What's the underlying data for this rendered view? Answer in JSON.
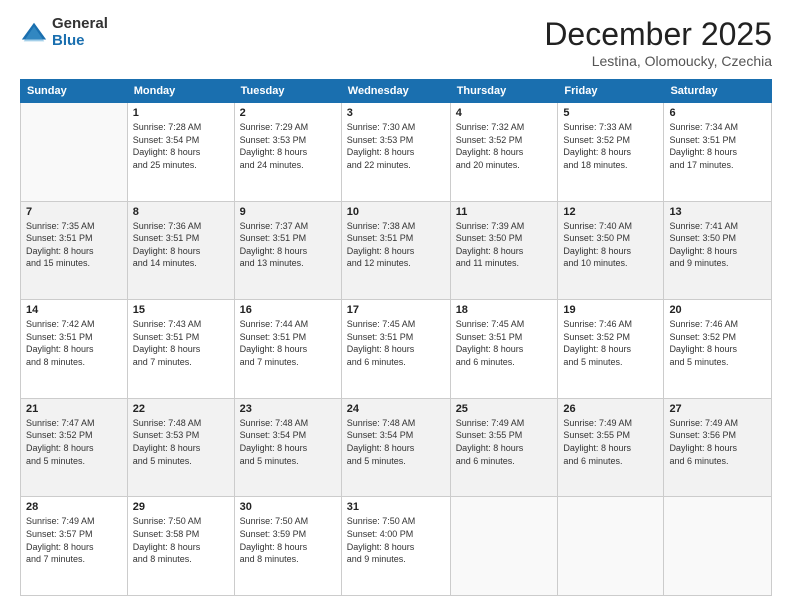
{
  "logo": {
    "general": "General",
    "blue": "Blue"
  },
  "header": {
    "month": "December 2025",
    "location": "Lestina, Olomoucky, Czechia"
  },
  "days_of_week": [
    "Sunday",
    "Monday",
    "Tuesday",
    "Wednesday",
    "Thursday",
    "Friday",
    "Saturday"
  ],
  "weeks": [
    [
      {
        "num": "",
        "info": ""
      },
      {
        "num": "1",
        "info": "Sunrise: 7:28 AM\nSunset: 3:54 PM\nDaylight: 8 hours\nand 25 minutes."
      },
      {
        "num": "2",
        "info": "Sunrise: 7:29 AM\nSunset: 3:53 PM\nDaylight: 8 hours\nand 24 minutes."
      },
      {
        "num": "3",
        "info": "Sunrise: 7:30 AM\nSunset: 3:53 PM\nDaylight: 8 hours\nand 22 minutes."
      },
      {
        "num": "4",
        "info": "Sunrise: 7:32 AM\nSunset: 3:52 PM\nDaylight: 8 hours\nand 20 minutes."
      },
      {
        "num": "5",
        "info": "Sunrise: 7:33 AM\nSunset: 3:52 PM\nDaylight: 8 hours\nand 18 minutes."
      },
      {
        "num": "6",
        "info": "Sunrise: 7:34 AM\nSunset: 3:51 PM\nDaylight: 8 hours\nand 17 minutes."
      }
    ],
    [
      {
        "num": "7",
        "info": "Sunrise: 7:35 AM\nSunset: 3:51 PM\nDaylight: 8 hours\nand 15 minutes."
      },
      {
        "num": "8",
        "info": "Sunrise: 7:36 AM\nSunset: 3:51 PM\nDaylight: 8 hours\nand 14 minutes."
      },
      {
        "num": "9",
        "info": "Sunrise: 7:37 AM\nSunset: 3:51 PM\nDaylight: 8 hours\nand 13 minutes."
      },
      {
        "num": "10",
        "info": "Sunrise: 7:38 AM\nSunset: 3:51 PM\nDaylight: 8 hours\nand 12 minutes."
      },
      {
        "num": "11",
        "info": "Sunrise: 7:39 AM\nSunset: 3:50 PM\nDaylight: 8 hours\nand 11 minutes."
      },
      {
        "num": "12",
        "info": "Sunrise: 7:40 AM\nSunset: 3:50 PM\nDaylight: 8 hours\nand 10 minutes."
      },
      {
        "num": "13",
        "info": "Sunrise: 7:41 AM\nSunset: 3:50 PM\nDaylight: 8 hours\nand 9 minutes."
      }
    ],
    [
      {
        "num": "14",
        "info": "Sunrise: 7:42 AM\nSunset: 3:51 PM\nDaylight: 8 hours\nand 8 minutes."
      },
      {
        "num": "15",
        "info": "Sunrise: 7:43 AM\nSunset: 3:51 PM\nDaylight: 8 hours\nand 7 minutes."
      },
      {
        "num": "16",
        "info": "Sunrise: 7:44 AM\nSunset: 3:51 PM\nDaylight: 8 hours\nand 7 minutes."
      },
      {
        "num": "17",
        "info": "Sunrise: 7:45 AM\nSunset: 3:51 PM\nDaylight: 8 hours\nand 6 minutes."
      },
      {
        "num": "18",
        "info": "Sunrise: 7:45 AM\nSunset: 3:51 PM\nDaylight: 8 hours\nand 6 minutes."
      },
      {
        "num": "19",
        "info": "Sunrise: 7:46 AM\nSunset: 3:52 PM\nDaylight: 8 hours\nand 5 minutes."
      },
      {
        "num": "20",
        "info": "Sunrise: 7:46 AM\nSunset: 3:52 PM\nDaylight: 8 hours\nand 5 minutes."
      }
    ],
    [
      {
        "num": "21",
        "info": "Sunrise: 7:47 AM\nSunset: 3:52 PM\nDaylight: 8 hours\nand 5 minutes."
      },
      {
        "num": "22",
        "info": "Sunrise: 7:48 AM\nSunset: 3:53 PM\nDaylight: 8 hours\nand 5 minutes."
      },
      {
        "num": "23",
        "info": "Sunrise: 7:48 AM\nSunset: 3:54 PM\nDaylight: 8 hours\nand 5 minutes."
      },
      {
        "num": "24",
        "info": "Sunrise: 7:48 AM\nSunset: 3:54 PM\nDaylight: 8 hours\nand 5 minutes."
      },
      {
        "num": "25",
        "info": "Sunrise: 7:49 AM\nSunset: 3:55 PM\nDaylight: 8 hours\nand 6 minutes."
      },
      {
        "num": "26",
        "info": "Sunrise: 7:49 AM\nSunset: 3:55 PM\nDaylight: 8 hours\nand 6 minutes."
      },
      {
        "num": "27",
        "info": "Sunrise: 7:49 AM\nSunset: 3:56 PM\nDaylight: 8 hours\nand 6 minutes."
      }
    ],
    [
      {
        "num": "28",
        "info": "Sunrise: 7:49 AM\nSunset: 3:57 PM\nDaylight: 8 hours\nand 7 minutes."
      },
      {
        "num": "29",
        "info": "Sunrise: 7:50 AM\nSunset: 3:58 PM\nDaylight: 8 hours\nand 8 minutes."
      },
      {
        "num": "30",
        "info": "Sunrise: 7:50 AM\nSunset: 3:59 PM\nDaylight: 8 hours\nand 8 minutes."
      },
      {
        "num": "31",
        "info": "Sunrise: 7:50 AM\nSunset: 4:00 PM\nDaylight: 8 hours\nand 9 minutes."
      },
      {
        "num": "",
        "info": ""
      },
      {
        "num": "",
        "info": ""
      },
      {
        "num": "",
        "info": ""
      }
    ]
  ]
}
